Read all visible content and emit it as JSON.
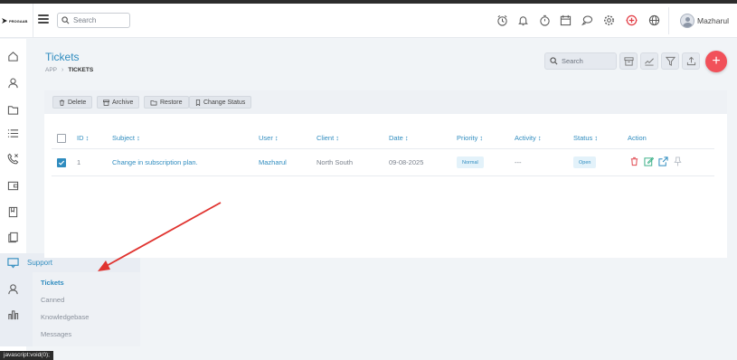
{
  "app": {
    "logo_text": "PROGAAB"
  },
  "header": {
    "search_placeholder": "Search",
    "user_name": "Mazharul",
    "icons": [
      "alarm-icon",
      "bell-icon",
      "timer-icon",
      "calendar-icon",
      "chat-icon",
      "gear-icon",
      "add-circle-icon",
      "globe-icon"
    ]
  },
  "sidebar": {
    "icons": [
      "home-icon",
      "contacts-icon",
      "folder-icon",
      "list-icon",
      "phone-icon",
      "wallet-icon",
      "book-icon",
      "files-icon",
      "support-icon",
      "user-icon",
      "chart-icon"
    ]
  },
  "flyout": {
    "title": "Support",
    "items": [
      {
        "label": "Tickets",
        "active": true
      },
      {
        "label": "Canned",
        "active": false
      },
      {
        "label": "Knowledgebase",
        "active": false
      },
      {
        "label": "Messages",
        "active": false
      }
    ]
  },
  "page": {
    "title": "Tickets",
    "breadcrumb": [
      "APP",
      "TICKETS"
    ],
    "search_placeholder": "Search"
  },
  "actions": [
    "Delete",
    "Archive",
    "Restore",
    "Change Status"
  ],
  "table": {
    "columns": [
      "ID ↕",
      "Subject ↕",
      "User ↕",
      "Client ↕",
      "Date ↕",
      "Priority ↕",
      "Activity ↕",
      "Status ↕",
      "Action"
    ],
    "rows": [
      {
        "id": "1",
        "subject": "Change in subscription plan.",
        "user": "Mazharul",
        "client": "North South",
        "date": "09-08-2025",
        "priority": "Normal",
        "activity": "---",
        "status": "Open",
        "checked": true
      }
    ]
  },
  "statusbar": {
    "text": "javascript:void(0);"
  },
  "colors": {
    "accent": "#2f8cbf",
    "fab": "#f1515a",
    "annotation_arrow": "#e0332f"
  }
}
